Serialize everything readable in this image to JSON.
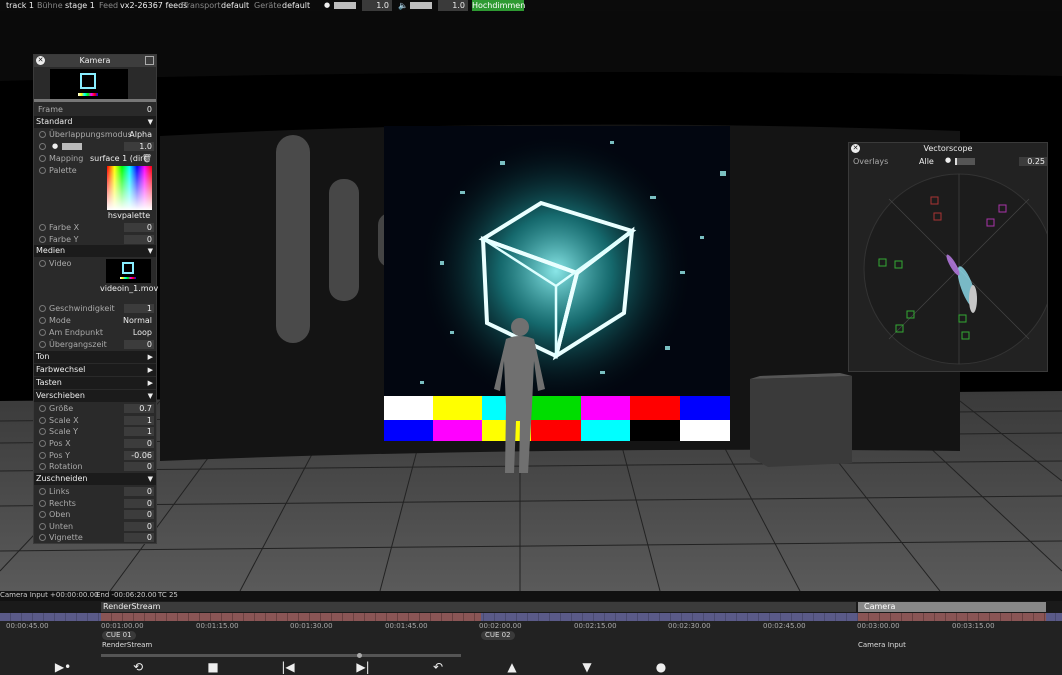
{
  "topbar": {
    "track": "track 1",
    "buehne_label": "Bühne",
    "buehne_value": "stage 1",
    "feed_label": "Feed",
    "feed_value": "vx2-26367 feeds",
    "transport_label": "Transport",
    "transport_value": "default",
    "geraete_label": "Geräte",
    "geraete_value": "default",
    "brightness_value": "1.0",
    "volume_value": "1.0",
    "hochdimmen": "Hochdimmen"
  },
  "camera_panel": {
    "title": "Kamera",
    "frame_label": "Frame",
    "frame_value": "0",
    "standard": "Standard",
    "overlap_label": "Überlappungsmodus",
    "overlap_value": "Alpha",
    "brightness_value": "1.0",
    "mapping_label": "Mapping",
    "mapping_value": "surface 1 (direct)",
    "palette_label": "Palette",
    "palette_name": "hsvpalette",
    "farbe_x_label": "Farbe X",
    "farbe_x_value": "0",
    "farbe_y_label": "Farbe Y",
    "farbe_y_value": "0",
    "medien": "Medien",
    "video_label": "Video",
    "video_name": "videoin_1.mov",
    "geschw_label": "Geschwindigkeit",
    "geschw_value": "1",
    "mode_label": "Mode",
    "mode_value": "Normal",
    "endpunkt_label": "Am Endpunkt",
    "endpunkt_value": "Loop",
    "uebergang_label": "Übergangszeit",
    "uebergang_value": "0",
    "ton": "Ton",
    "farbwechsel": "Farbwechsel",
    "tasten": "Tasten",
    "verschieben": "Verschieben",
    "groesse_label": "Größe",
    "groesse_value": "0.7",
    "scale_x_label": "Scale X",
    "scale_x_value": "1",
    "scale_y_label": "Scale Y",
    "scale_y_value": "1",
    "pos_x_label": "Pos X",
    "pos_x_value": "0",
    "pos_y_label": "Pos Y",
    "pos_y_value": "-0.06",
    "rotation_label": "Rotation",
    "rotation_value": "0",
    "zuschneiden": "Zuschneiden",
    "links_label": "Links",
    "links_value": "0",
    "rechts_label": "Rechts",
    "rechts_value": "0",
    "oben_label": "Oben",
    "oben_value": "0",
    "unten_label": "Unten",
    "unten_value": "0",
    "vignette_label": "Vignette",
    "vignette_value": "0"
  },
  "vectorscope": {
    "title": "Vectorscope",
    "overlays_label": "Overlays",
    "overlays_value": "Alle",
    "value": "0.25"
  },
  "timeline": {
    "status_input": "Camera Input +00:00:00.00",
    "status_end": "End -00:06:20.00",
    "status_tc": "TC 25",
    "renderstream_track": "RenderStream",
    "camera_track": "Camera",
    "ticks": [
      "00:00:45.00",
      "00:01:00.00",
      "00:01:15.00",
      "00:01:30.00",
      "00:01:45.00",
      "00:02:00.00",
      "00:02:15.00",
      "00:02:30.00",
      "00:02:45.00",
      "00:03:00.00",
      "00:03:15.00"
    ],
    "cue1": "CUE 01",
    "cue1_sub": "RenderStream",
    "cue2": "CUE 02",
    "camera_input": "Camera Input"
  }
}
